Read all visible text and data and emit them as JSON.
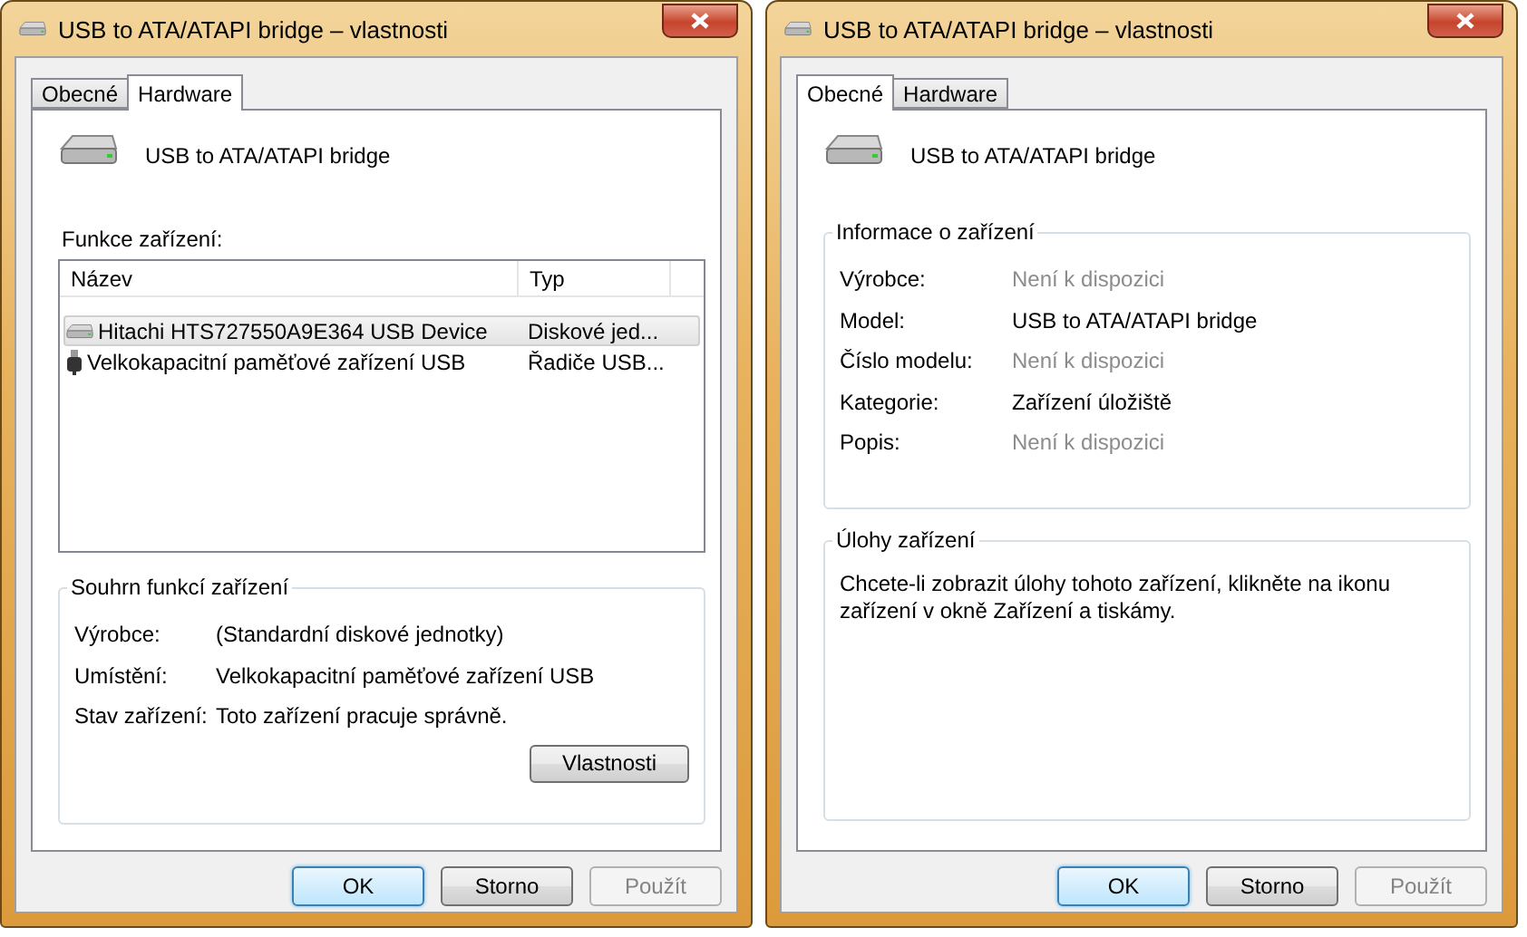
{
  "windows": [
    {
      "title": "USB to ATA/ATAPI bridge – vlastnosti",
      "tabs": [
        {
          "label": "Obecné",
          "selected": false
        },
        {
          "label": "Hardware",
          "selected": true
        }
      ],
      "device_name": "USB to ATA/ATAPI bridge",
      "panel": {
        "kind": "hardware",
        "list_label": "Funkce zařízení:",
        "columns": [
          "Název",
          "Typ"
        ],
        "rows": [
          {
            "kind": "disk",
            "name": "Hitachi HTS727550A9E364 USB Device",
            "type": "Diskové jed...",
            "selected": true
          },
          {
            "kind": "usb",
            "name": "Velkokapacitní paměťové zařízení USB",
            "type": "Řadiče USB...",
            "selected": false
          }
        ],
        "group_title": "Souhrn funkcí zařízení",
        "properties": [
          {
            "label": "Výrobce:",
            "value": "(Standardní diskové jednotky)"
          },
          {
            "label": "Umístění:",
            "value": "Velkokapacitní paměťové zařízení USB"
          },
          {
            "label": "Stav zařízení:",
            "value": "Toto zařízení pracuje správně."
          }
        ],
        "button": "Vlastnosti"
      },
      "buttons": [
        {
          "label": "OK",
          "default": true,
          "disabled": false
        },
        {
          "label": "Storno",
          "default": false,
          "disabled": false
        },
        {
          "label": "Použít",
          "default": false,
          "disabled": true
        }
      ]
    },
    {
      "title": "USB to ATA/ATAPI bridge – vlastnosti",
      "tabs": [
        {
          "label": "Obecné",
          "selected": true
        },
        {
          "label": "Hardware",
          "selected": false
        }
      ],
      "device_name": "USB to ATA/ATAPI bridge",
      "panel": {
        "kind": "general",
        "info_title": "Informace o zařízení",
        "info": [
          {
            "label": "Výrobce:",
            "value": "Není k dispozici",
            "available": false
          },
          {
            "label": "Model:",
            "value": "USB to ATA/ATAPI bridge",
            "available": true
          },
          {
            "label": "Číslo modelu:",
            "value": "Není k dispozici",
            "available": false
          },
          {
            "label": "Kategorie:",
            "value": "Zařízení úložiště",
            "available": true
          },
          {
            "label": "Popis:",
            "value": "Není k dispozici",
            "available": false
          }
        ],
        "tasks_title": "Úlohy zařízení",
        "tasks_text": "Chcete-li zobrazit úlohy tohoto zařízení, klikněte na ikonu zařízení v okně Zařízení a tiskámy."
      },
      "buttons": [
        {
          "label": "OK",
          "default": true,
          "disabled": false
        },
        {
          "label": "Storno",
          "default": false,
          "disabled": false
        },
        {
          "label": "Použít",
          "default": false,
          "disabled": true
        }
      ]
    }
  ]
}
